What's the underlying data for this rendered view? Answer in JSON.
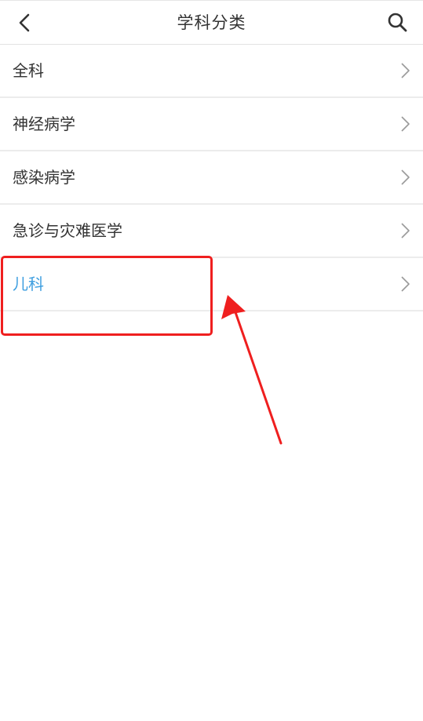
{
  "header": {
    "title": "学科分类",
    "back_icon": "chevron-left-icon",
    "search_icon": "search-icon"
  },
  "categories": [
    {
      "label": "全科",
      "active": false
    },
    {
      "label": "神经病学",
      "active": false
    },
    {
      "label": "感染病学",
      "active": false
    },
    {
      "label": "急诊与灾难医学",
      "active": false
    },
    {
      "label": "儿科",
      "active": true
    }
  ],
  "colors": {
    "active_text": "#3f9fe0",
    "text": "#333333",
    "annotation": "#ef1f1f"
  }
}
